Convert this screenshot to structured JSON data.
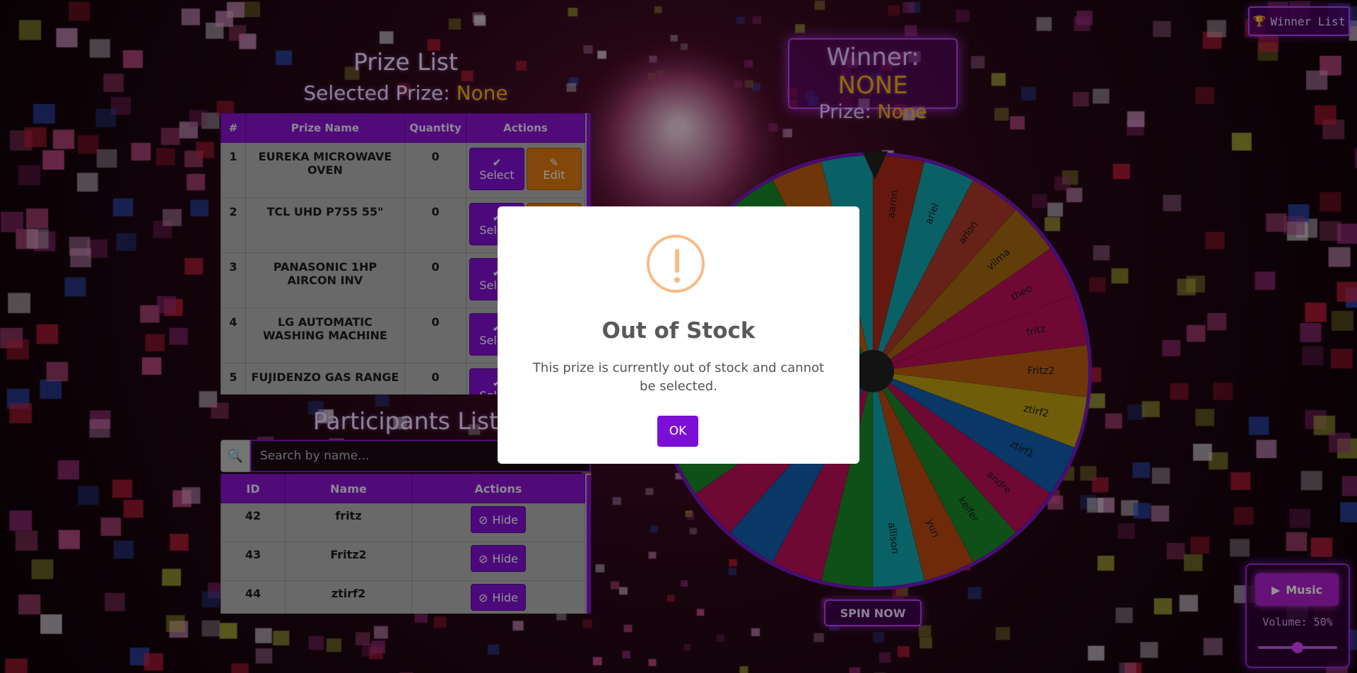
{
  "winner_list": {
    "label": "Winner List",
    "icon": "trophy-icon"
  },
  "winner_box": {
    "winner_label": "Winner:",
    "winner_value": "NONE",
    "prize_label": "Prize:",
    "prize_value": "None"
  },
  "prize_list": {
    "title": "Prize List",
    "selected_label": "Selected Prize:",
    "selected_value": "None",
    "headers": [
      "#",
      "Prize Name",
      "Quantity",
      "Actions"
    ],
    "select_label": "Select",
    "edit_label": "Edit",
    "rows": [
      {
        "num": "1",
        "name": "EUREKA MICROWAVE OVEN",
        "qty": "0"
      },
      {
        "num": "2",
        "name": "TCL UHD P755 55\"",
        "qty": "0"
      },
      {
        "num": "3",
        "name": "PANASONIC 1HP AIRCON INV",
        "qty": "0"
      },
      {
        "num": "4",
        "name": "LG AUTOMATIC WASHING MACHINE",
        "qty": "0"
      },
      {
        "num": "5",
        "name": "FUJIDENZO GAS RANGE",
        "qty": "0"
      }
    ]
  },
  "participants": {
    "title": "Participants List",
    "search_placeholder": "Search by name...",
    "headers": [
      "ID",
      "Name",
      "Actions"
    ],
    "hide_label": "Hide",
    "rows": [
      {
        "id": "42",
        "name": "fritz"
      },
      {
        "id": "43",
        "name": "Fritz2"
      },
      {
        "id": "44",
        "name": "ztirf2"
      }
    ]
  },
  "wheel": {
    "labels": [
      "aaron",
      "ariel",
      "arlon",
      "vilma",
      "theo",
      "fritz",
      "Fritz2",
      "ztirf2",
      "ztirf1",
      "andre",
      "keifer",
      "yuri",
      "allison"
    ],
    "colors": [
      "#b02a1a",
      "#10a8b0",
      "#b03a2a",
      "#a86a10",
      "#c0105a",
      "#c0105a",
      "#c06010",
      "#c0a010",
      "#1060b0",
      "#c0105a",
      "#1a8a2a",
      "#c04a10",
      "#10a8b0"
    ],
    "ring_color": "#7a18c8"
  },
  "spin_button": {
    "label": "SPIN NOW"
  },
  "music": {
    "label": "Music",
    "volume_label": "Volume: 50%",
    "volume": 0.5
  },
  "modal": {
    "title": "Out of Stock",
    "text": "This prize is currently out of stock and cannot be selected.",
    "ok_label": "OK"
  }
}
